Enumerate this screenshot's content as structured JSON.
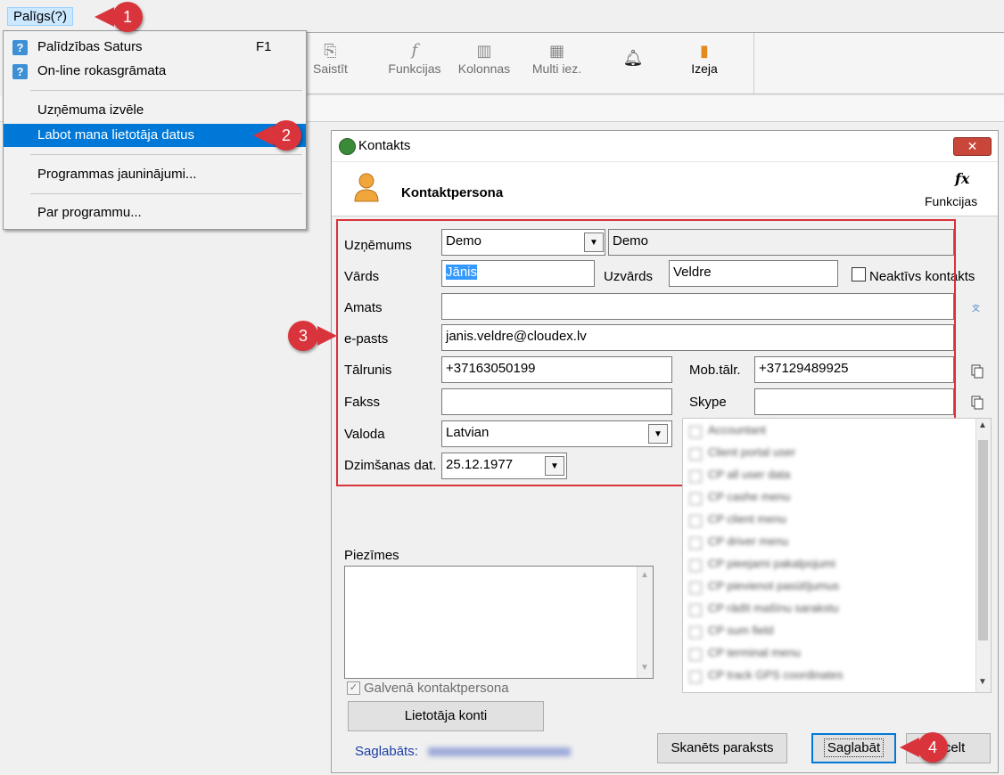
{
  "menubar": {
    "help_menu": "Palīgs(?)"
  },
  "help_menu": {
    "items": [
      {
        "label": "Palīdzības Saturs",
        "shortcut": "F1"
      },
      {
        "label": "On-line rokasgrāmata"
      },
      {
        "label": "Uzņēmuma izvēle"
      },
      {
        "label": "Labot mana lietotāja datus"
      },
      {
        "label": "Programmas jauninājumi..."
      },
      {
        "label": "Par programmu..."
      }
    ]
  },
  "toolbar": {
    "items": [
      "Saistīt",
      "Funkcijas",
      "Kolonnas",
      "Multi iez.",
      "Izeja"
    ]
  },
  "dialog": {
    "title": "Kontakts",
    "header_title": "Kontaktpersona",
    "functions_label": "Funkcijas",
    "functions_icon": "fx",
    "fields": {
      "company_label": "Uzņēmums",
      "company_value": "Demo",
      "company_name": "Demo",
      "first_name_label": "Vārds",
      "first_name_value": "Jānis",
      "last_name_label": "Uzvārds",
      "last_name_value": "Veldre",
      "inactive_label": "Neaktīvs kontakts",
      "position_label": "Amats",
      "position_value": "",
      "email_label": "e-pasts",
      "email_value": "janis.veldre@cloudex.lv",
      "phone_label": "Tālrunis",
      "phone_value": "+37163050199",
      "mobile_label": "Mob.tālr.",
      "mobile_value": "+37129489925",
      "fax_label": "Fakss",
      "fax_value": "",
      "skype_label": "Skype",
      "skype_value": "",
      "language_label": "Valoda",
      "language_value": "Latvian",
      "birth_label": "Dzimšanas dat.",
      "birth_value": "25.12.1977"
    },
    "notes_label": "Piezīmes",
    "main_contact_label": "Galvenā kontaktpersona",
    "user_accounts_button": "Lietotāja konti",
    "saved_label": "Saglabāts:",
    "scanned_signature_button": "Skanēts paraksts",
    "save_button": "Saglabāt",
    "cancel_button": "Atcelt",
    "roles": [
      "Accountant",
      "Client portal user",
      "CP all user data",
      "CP cashe menu",
      "CP client menu",
      "CP driver menu",
      "CP pieejami pakalpojumi",
      "CP pievienot pasūtījumus",
      "CP rādīt mašīnu sarakstu",
      "CP sum field",
      "CP terminal menu",
      "CP track GPS coordinates"
    ]
  },
  "callouts": [
    "1",
    "2",
    "3",
    "4"
  ],
  "colors": {
    "accent": "#0078d7",
    "callout": "#d9343b",
    "highlight_box": "#d9323a"
  }
}
